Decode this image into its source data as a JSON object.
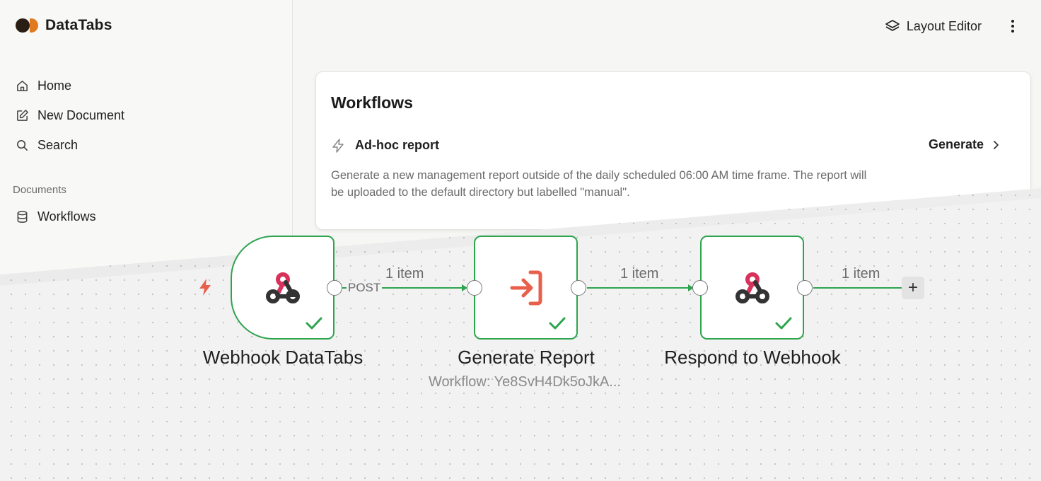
{
  "brand": {
    "name": "DataTabs",
    "logo_icon": "datatabs-logo"
  },
  "sidebar": {
    "items": [
      {
        "label": "Home",
        "icon": "home-icon"
      },
      {
        "label": "New Document",
        "icon": "edit-icon"
      },
      {
        "label": "Search",
        "icon": "search-icon"
      }
    ],
    "section_label": "Documents",
    "documents": [
      {
        "label": "Workflows",
        "icon": "database-icon"
      }
    ]
  },
  "topbar": {
    "layout_editor_label": "Layout Editor",
    "layout_editor_icon": "layers-icon",
    "more_icon": "more-vertical-icon"
  },
  "card": {
    "title": "Workflows",
    "workflow": {
      "name": "Ad-hoc report",
      "icon": "bolt-icon",
      "action_label": "Generate",
      "description": "Generate a new management report outside of the daily scheduled 06:00 AM time frame. The report will be uploaded to the default directory but labelled \"manual\"."
    }
  },
  "workflow_canvas": {
    "nodes": [
      {
        "label": "Webhook DataTabs",
        "icon": "webhook-icon",
        "status": "success"
      },
      {
        "label": "Generate Report",
        "sublabel": "Workflow: Ye8SvH4Dk5oJkA...",
        "icon": "sign-in-icon",
        "status": "success"
      },
      {
        "label": "Respond to Webhook",
        "icon": "webhook-icon",
        "status": "success"
      }
    ],
    "edges": [
      {
        "label": "1 item",
        "method": "POST"
      },
      {
        "label": "1 item"
      },
      {
        "label": "1 item"
      }
    ],
    "add_node_label": "+"
  },
  "colors": {
    "success_green": "#2ea44f",
    "webhook_pink": "#d8315b",
    "accent_orange": "#e8604c",
    "text_dark": "#1f1f1f",
    "text_muted": "#6a6a6a"
  }
}
